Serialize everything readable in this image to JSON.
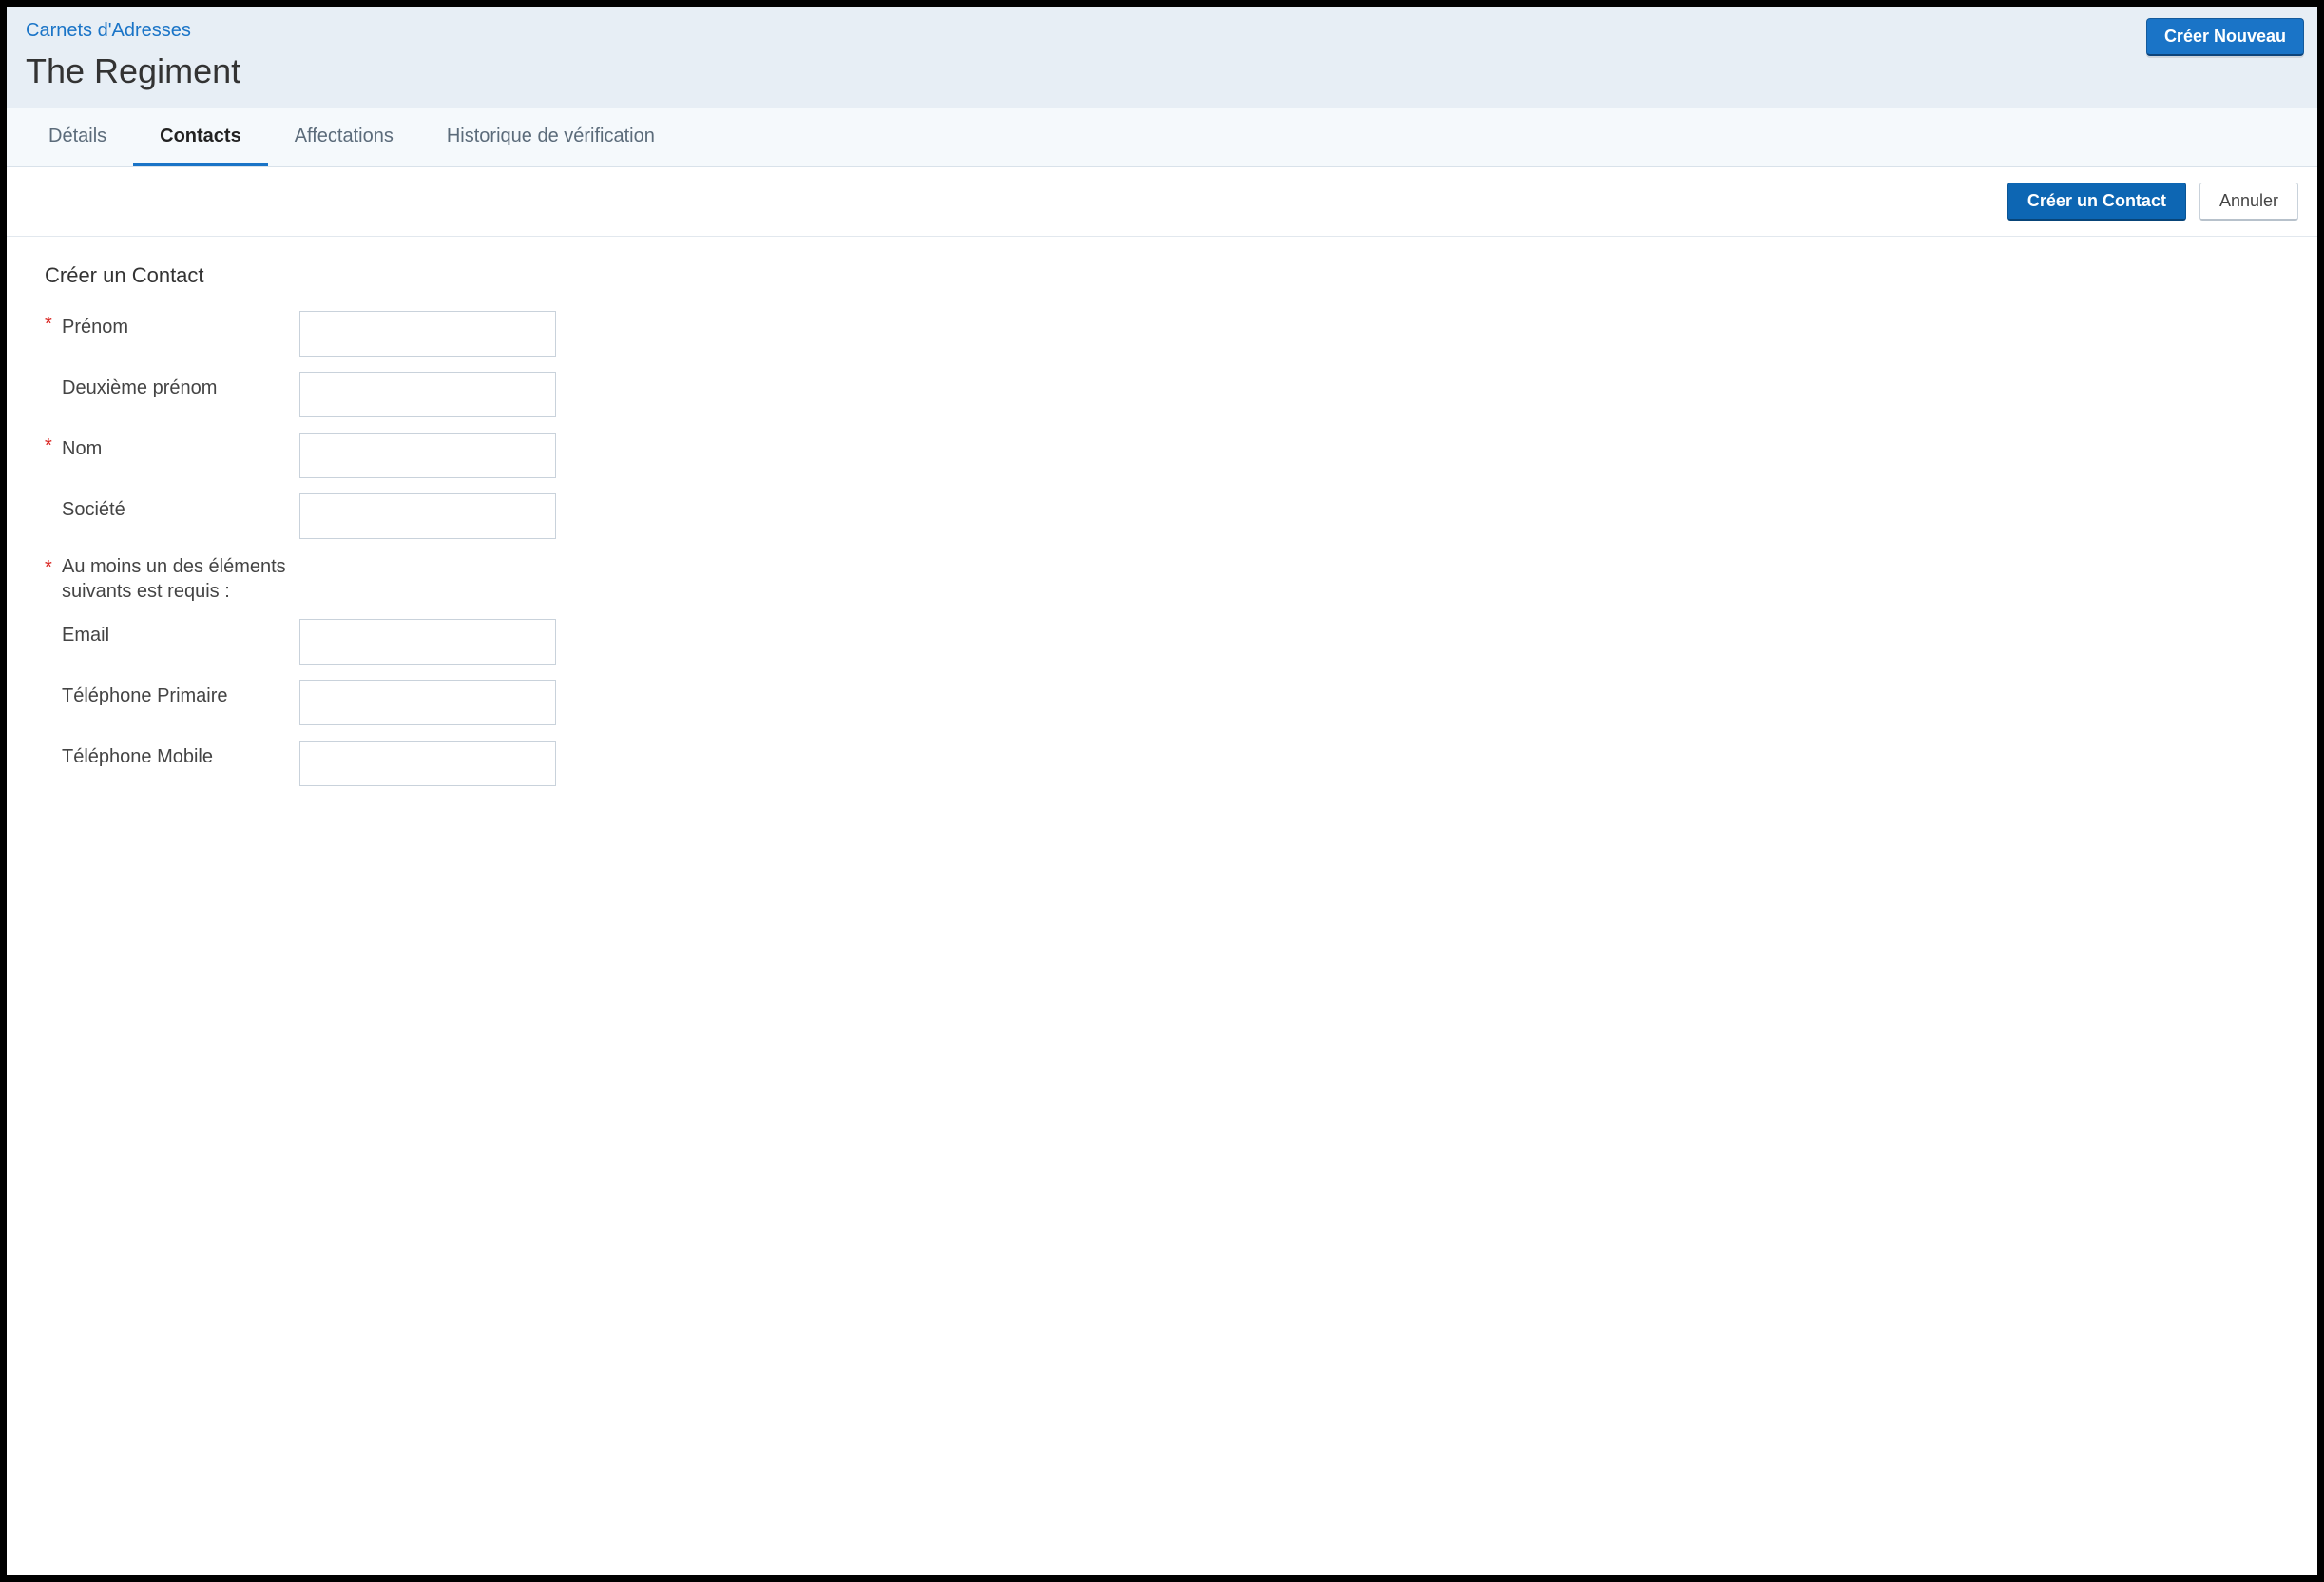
{
  "header": {
    "breadcrumb": "Carnets d'Adresses",
    "title": "The Regiment",
    "create_new_label": "Créer Nouveau"
  },
  "tabs": {
    "details": "Détails",
    "contacts": "Contacts",
    "assignments": "Affectations",
    "verification_history": "Historique de vérification"
  },
  "action_bar": {
    "create_contact": "Créer un Contact",
    "cancel": "Annuler"
  },
  "form": {
    "heading": "Créer un Contact",
    "required_mark": "*",
    "fields": {
      "first_name": {
        "label": "Prénom",
        "value": ""
      },
      "middle_name": {
        "label": "Deuxième prénom",
        "value": ""
      },
      "last_name": {
        "label": "Nom",
        "value": ""
      },
      "company": {
        "label": "Société",
        "value": ""
      },
      "email": {
        "label": "Email",
        "value": ""
      },
      "primary_phone": {
        "label": "Téléphone Primaire",
        "value": ""
      },
      "mobile_phone": {
        "label": "Téléphone Mobile",
        "value": ""
      }
    },
    "at_least_one_note": "Au moins un des éléments suivants est requis :"
  }
}
